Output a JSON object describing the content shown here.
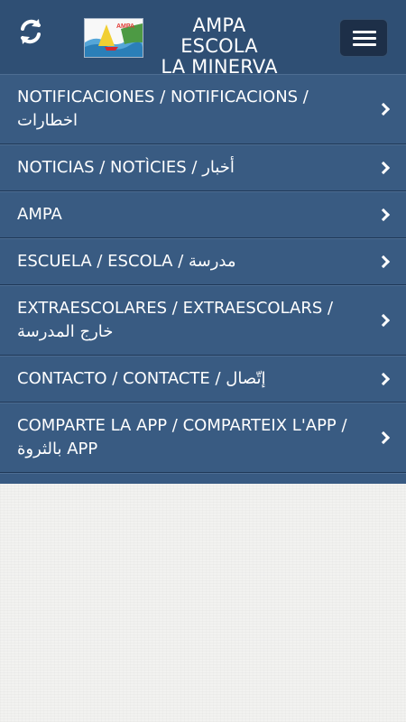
{
  "header": {
    "title_line1": "AMPA ESCOLA",
    "title_line2": "LA MINERVA",
    "logo_text": "AMPA",
    "refresh_icon": "refresh-icon",
    "menu_icon": "hamburger-icon"
  },
  "menu": {
    "items": [
      {
        "label": "NOTIFICACIONES / NOTIFICACIONS / اخطارات"
      },
      {
        "label": "NOTICIAS / NOTÌCIES / أخبار"
      },
      {
        "label": "AMPA"
      },
      {
        "label": "ESCUELA / ESCOLA / مدرسة"
      },
      {
        "label": "EXTRAESCOLARES / EXTRAESCOLARS / خارج المدرسة"
      },
      {
        "label": "CONTACTO / CONTACTE / إتّصال"
      },
      {
        "label": "COMPARTE LA APP / COMPARTEIX L'APP / بالثروة APP"
      }
    ]
  },
  "colors": {
    "header_bg": "#2f4f74",
    "menu_bg": "#385a82",
    "page_bg": "#f2f2f0"
  }
}
